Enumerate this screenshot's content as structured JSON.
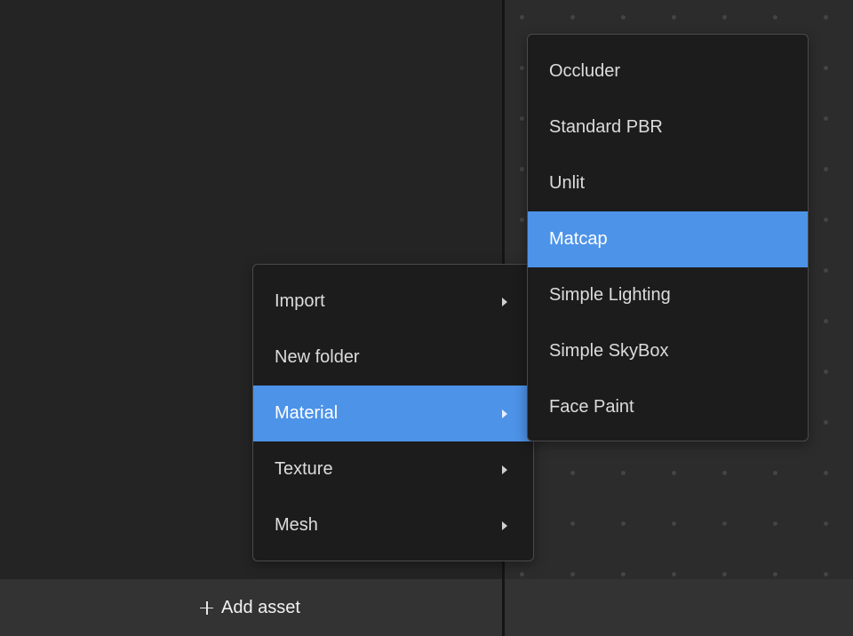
{
  "context_menu": {
    "items": [
      {
        "label": "Import",
        "has_submenu": true,
        "selected": false
      },
      {
        "label": "New folder",
        "has_submenu": false,
        "selected": false
      },
      {
        "label": "Material",
        "has_submenu": true,
        "selected": true
      },
      {
        "label": "Texture",
        "has_submenu": true,
        "selected": false
      },
      {
        "label": "Mesh",
        "has_submenu": true,
        "selected": false
      }
    ]
  },
  "material_submenu": {
    "items": [
      {
        "label": "Occluder",
        "selected": false
      },
      {
        "label": "Standard PBR",
        "selected": false
      },
      {
        "label": "Unlit",
        "selected": false
      },
      {
        "label": "Matcap",
        "selected": true
      },
      {
        "label": "Simple Lighting",
        "selected": false
      },
      {
        "label": "Simple SkyBox",
        "selected": false
      },
      {
        "label": "Face Paint",
        "selected": false
      }
    ]
  },
  "bottom_bar": {
    "add_asset_label": "Add asset",
    "add_icon": "plus-icon"
  },
  "colors": {
    "highlight": "#4d93e8",
    "menu_background": "#1c1c1c",
    "panel_background": "#242424",
    "canvas_background": "#2c2c2c"
  }
}
